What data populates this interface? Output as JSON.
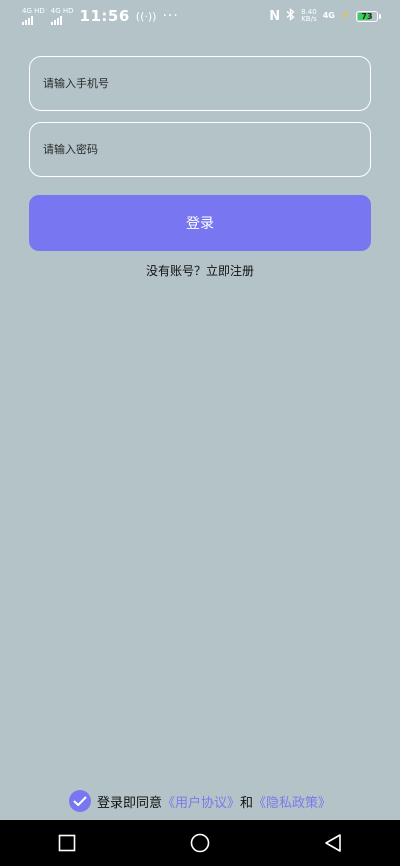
{
  "status_bar": {
    "net1": "4G HD",
    "net2": "4G HD",
    "time": "11:56",
    "wifi_call": "((·))",
    "more": "···",
    "speed_value": "8.40",
    "speed_unit": "KB/s",
    "network": "4G",
    "battery": "73",
    "battery_level": 0.73
  },
  "form": {
    "phone_placeholder": "请输入手机号",
    "password_placeholder": "请输入密码",
    "login_label": "登录",
    "register_text": "没有账号？立即注册"
  },
  "agreement": {
    "prefix": "登录即同意",
    "user_agreement": "《用户协议》",
    "and": "和",
    "privacy_policy": "《隐私政策》",
    "checked": true
  },
  "colors": {
    "background": "#b3c3c8",
    "accent": "#7876f0",
    "link": "#7b79ec",
    "battery": "#3ad15b"
  },
  "icons": {
    "status": [
      "signal-icon",
      "nfc-icon",
      "bluetooth-icon",
      "charging-icon",
      "battery-icon"
    ],
    "navigation": [
      "recent-apps-icon",
      "home-icon",
      "back-icon"
    ]
  }
}
